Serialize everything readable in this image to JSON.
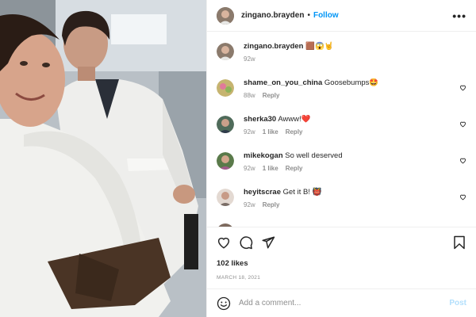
{
  "post": {
    "username": "zingano.brayden",
    "follow_label": "Follow",
    "separator": "•",
    "more_label": "•••"
  },
  "caption": {
    "username": "zingano.brayden",
    "text": "🟫😱🤘",
    "time": "92w"
  },
  "comments": [
    {
      "username": "shame_on_you_china",
      "text": "Goosebumps🤩",
      "time": "88w",
      "likes": "",
      "reply": "Reply"
    },
    {
      "username": "sherka30",
      "text": "Awww!❤️",
      "time": "92w",
      "likes": "1 like",
      "reply": "Reply"
    },
    {
      "username": "mikekogan",
      "text": "So well deserved",
      "time": "92w",
      "likes": "1 like",
      "reply": "Reply"
    },
    {
      "username": "heyitscrae",
      "text": "Get it B! 👹",
      "time": "92w",
      "likes": "",
      "reply": "Reply"
    }
  ],
  "engagement": {
    "likes": "102 likes",
    "date": "MARCH 18, 2021"
  },
  "composer": {
    "placeholder": "Add a comment...",
    "post_label": "Post"
  },
  "icons": {
    "like": "heart-icon",
    "comment": "comment-bubble-icon",
    "share": "paper-plane-icon",
    "save": "bookmark-icon",
    "emoji": "smiley-icon",
    "more": "ellipsis-icon"
  },
  "colors": {
    "accent": "#0095f6",
    "accent_disabled": "#b2dffc",
    "muted": "#8e8e8e",
    "heart_red": "#ed4956"
  }
}
